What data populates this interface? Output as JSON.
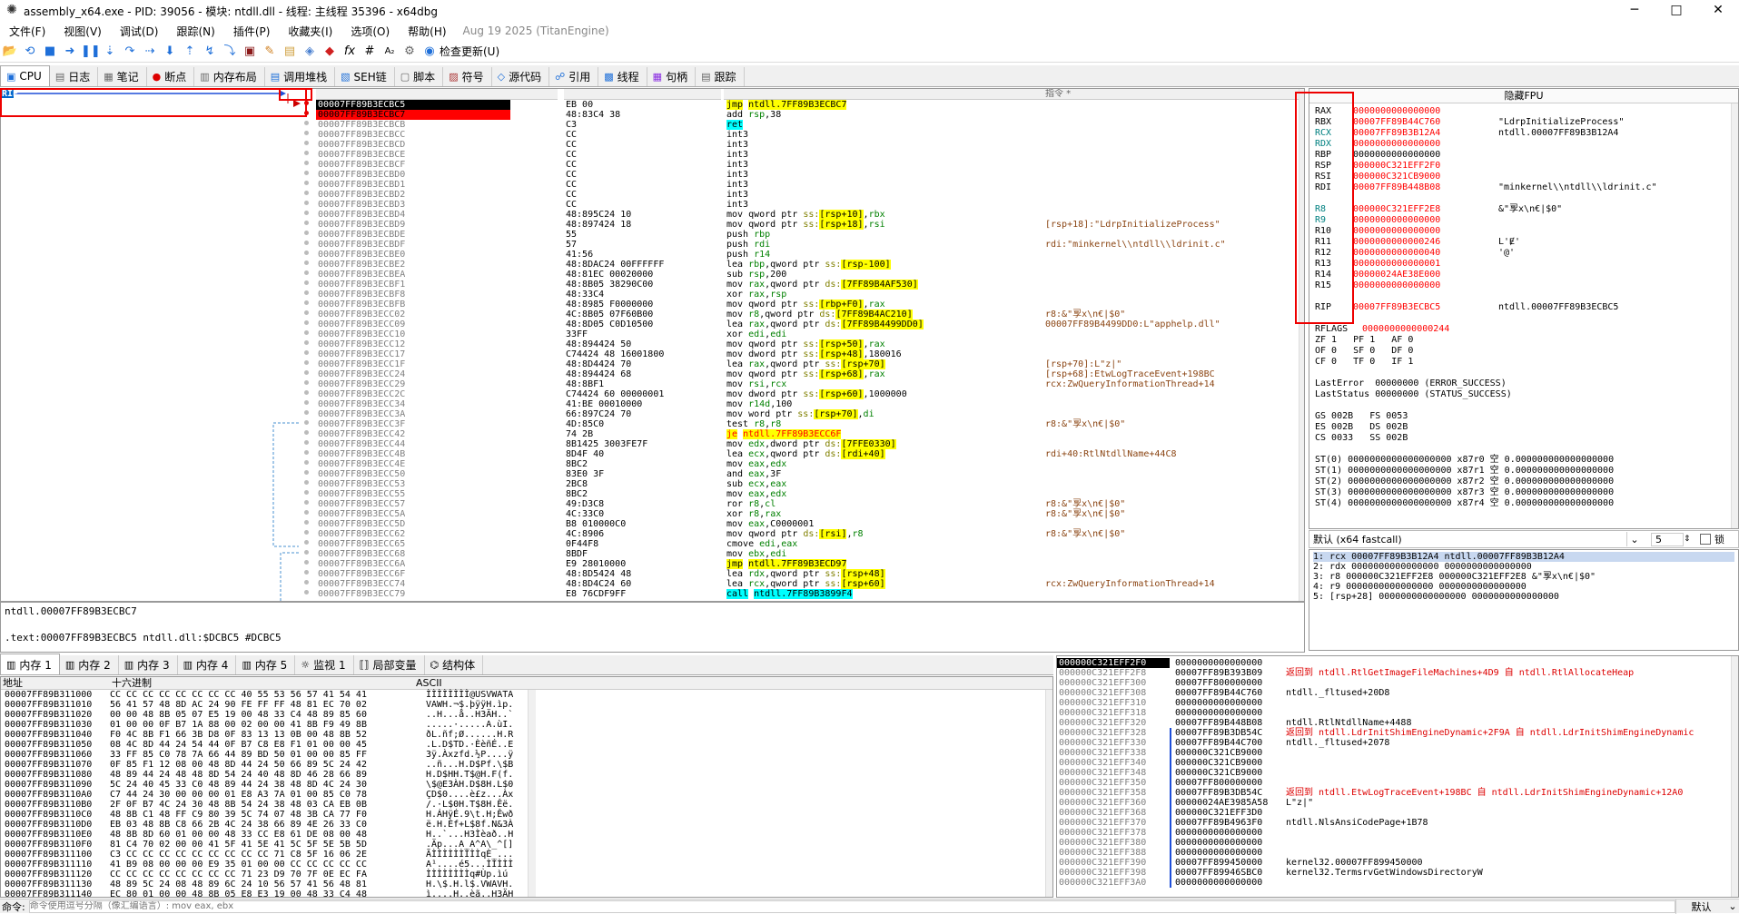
{
  "window": {
    "title": "assembly_x64.exe - PID: 39056 - 模块: ntdll.dll - 线程: 主线程 35396 - x64dbg",
    "minimize": "─",
    "maximize": "□",
    "close": "✕"
  },
  "menu": {
    "items": [
      "文件(F)",
      "视图(V)",
      "调试(D)",
      "跟踪(N)",
      "插件(P)",
      "收藏夹(I)",
      "选项(O)",
      "帮助(H)"
    ],
    "version": "Aug 19 2025 (TitanEngine)"
  },
  "toolbar": {
    "icons": [
      "open-icon",
      "restart-icon",
      "stop-icon",
      "run-icon",
      "pause-icon",
      "step-into-icon",
      "step-over-icon",
      "run-to-return-icon",
      "run-to-user-icon",
      "step-out-icon",
      "trace-into-icon",
      "trace-over-icon",
      "scylla-icon",
      "patch-icon",
      "comment-icon",
      "label-icon",
      "bookmark-icon",
      "function-icon",
      "hash-icon",
      "font-icon",
      "options-icon",
      "update-icon"
    ],
    "update_label": "检查更新(U)"
  },
  "tabs": [
    {
      "icon": "cpu-icon",
      "label": "CPU"
    },
    {
      "icon": "log-icon",
      "label": "日志"
    },
    {
      "icon": "notes-icon",
      "label": "笔记"
    },
    {
      "icon": "breakpoint-icon",
      "label": "断点"
    },
    {
      "icon": "memory-map-icon",
      "label": "内存布局"
    },
    {
      "icon": "callstack-icon",
      "label": "调用堆栈"
    },
    {
      "icon": "seh-icon",
      "label": "SEH链"
    },
    {
      "icon": "script-icon",
      "label": "脚本"
    },
    {
      "icon": "symbols-icon",
      "label": "符号"
    },
    {
      "icon": "source-icon",
      "label": "源代码"
    },
    {
      "icon": "references-icon",
      "label": "引用"
    },
    {
      "icon": "threads-icon",
      "label": "线程"
    },
    {
      "icon": "handles-icon",
      "label": "句柄"
    },
    {
      "icon": "trace-icon",
      "label": "跟踪"
    }
  ],
  "cpu": {
    "rip_label": "RIP",
    "col_header": "指令 *",
    "rows": [
      {
        "addr": "00007FF89B3ECBC5",
        "bytes": "EB 00",
        "asm": "jmp ntdll.7FF89B3ECBC7",
        "cmt": ""
      },
      {
        "addr": "00007FF89B3ECBC7",
        "bytes": "48:83C4 38",
        "asm": "add rsp,38",
        "cmt": ""
      },
      {
        "addr": "00007FF89B3ECBCB",
        "bytes": "C3",
        "asm": "ret",
        "cmt": ""
      },
      {
        "addr": "00007FF89B3ECBCC",
        "bytes": "CC",
        "asm": "int3",
        "cmt": ""
      },
      {
        "addr": "00007FF89B3ECBCD",
        "bytes": "CC",
        "asm": "int3",
        "cmt": ""
      },
      {
        "addr": "00007FF89B3ECBCE",
        "bytes": "CC",
        "asm": "int3",
        "cmt": ""
      },
      {
        "addr": "00007FF89B3ECBCF",
        "bytes": "CC",
        "asm": "int3",
        "cmt": ""
      },
      {
        "addr": "00007FF89B3ECBD0",
        "bytes": "CC",
        "asm": "int3",
        "cmt": ""
      },
      {
        "addr": "00007FF89B3ECBD1",
        "bytes": "CC",
        "asm": "int3",
        "cmt": ""
      },
      {
        "addr": "00007FF89B3ECBD2",
        "bytes": "CC",
        "asm": "int3",
        "cmt": ""
      },
      {
        "addr": "00007FF89B3ECBD3",
        "bytes": "CC",
        "asm": "int3",
        "cmt": ""
      },
      {
        "addr": "00007FF89B3ECBD4",
        "bytes": "48:895C24 10",
        "asm": "mov qword ptr ss:[rsp+10],rbx",
        "cmt": ""
      },
      {
        "addr": "00007FF89B3ECBD9",
        "bytes": "48:897424 18",
        "asm": "mov qword ptr ss:[rsp+18],rsi",
        "cmt": "[rsp+18]:\"LdrpInitializeProcess\""
      },
      {
        "addr": "00007FF89B3ECBDE",
        "bytes": "55",
        "asm": "push rbp",
        "cmt": ""
      },
      {
        "addr": "00007FF89B3ECBDF",
        "bytes": "57",
        "asm": "push rdi",
        "cmt": "rdi:\"minkernel\\\\ntdll\\\\ldrinit.c\""
      },
      {
        "addr": "00007FF89B3ECBE0",
        "bytes": "41:56",
        "asm": "push r14",
        "cmt": ""
      },
      {
        "addr": "00007FF89B3ECBE2",
        "bytes": "48:8DAC24 00FFFFFF",
        "asm": "lea rbp,qword ptr ss:[rsp-100]",
        "cmt": ""
      },
      {
        "addr": "00007FF89B3ECBEA",
        "bytes": "48:81EC 00020000",
        "asm": "sub rsp,200",
        "cmt": ""
      },
      {
        "addr": "00007FF89B3ECBF1",
        "bytes": "48:8B05 38290C00",
        "asm": "mov rax,qword ptr ds:[7FF89B4AF530]",
        "cmt": ""
      },
      {
        "addr": "00007FF89B3ECBF8",
        "bytes": "48:33C4",
        "asm": "xor rax,rsp",
        "cmt": ""
      },
      {
        "addr": "00007FF89B3ECBFB",
        "bytes": "48:8985 F0000000",
        "asm": "mov qword ptr ss:[rbp+F0],rax",
        "cmt": ""
      },
      {
        "addr": "00007FF89B3ECC02",
        "bytes": "4C:8B05 07F60B00",
        "asm": "mov r8,qword ptr ds:[7FF89B4AC210]",
        "cmt": "r8:&\"孠x\\n€|$0\""
      },
      {
        "addr": "00007FF89B3ECC09",
        "bytes": "48:8D05 C0D10500",
        "asm": "lea rax,qword ptr ds:[7FF89B4499DD0]",
        "cmt": "00007FF89B4499DD0:L\"apphelp.dll\""
      },
      {
        "addr": "00007FF89B3ECC10",
        "bytes": "33FF",
        "asm": "xor edi,edi",
        "cmt": ""
      },
      {
        "addr": "00007FF89B3ECC12",
        "bytes": "48:894424 50",
        "asm": "mov qword ptr ss:[rsp+50],rax",
        "cmt": ""
      },
      {
        "addr": "00007FF89B3ECC17",
        "bytes": "C74424 48 16001800",
        "asm": "mov dword ptr ss:[rsp+48],180016",
        "cmt": ""
      },
      {
        "addr": "00007FF89B3ECC1F",
        "bytes": "48:8D4424 70",
        "asm": "lea rax,qword ptr ss:[rsp+70]",
        "cmt": "[rsp+70]:L\"z|\""
      },
      {
        "addr": "00007FF89B3ECC24",
        "bytes": "48:894424 68",
        "asm": "mov qword ptr ss:[rsp+68],rax",
        "cmt": "[rsp+68]:EtwLogTraceEvent+198BC"
      },
      {
        "addr": "00007FF89B3ECC29",
        "bytes": "48:8BF1",
        "asm": "mov rsi,rcx",
        "cmt": "rcx:ZwQueryInformationThread+14"
      },
      {
        "addr": "00007FF89B3ECC2C",
        "bytes": "C74424 60 00000001",
        "asm": "mov dword ptr ss:[rsp+60],1000000",
        "cmt": ""
      },
      {
        "addr": "00007FF89B3ECC34",
        "bytes": "41:BE 00010000",
        "asm": "mov r14d,100",
        "cmt": ""
      },
      {
        "addr": "00007FF89B3ECC3A",
        "bytes": "66:897C24 70",
        "asm": "mov word ptr ss:[rsp+70],di",
        "cmt": ""
      },
      {
        "addr": "00007FF89B3ECC3F",
        "bytes": "4D:85C0",
        "asm": "test r8,r8",
        "cmt": "r8:&\"孠x\\n€|$0\""
      },
      {
        "addr": "00007FF89B3ECC42",
        "bytes": "74 2B",
        "asm": "je ntdll.7FF89B3ECC6F",
        "cmt": ""
      },
      {
        "addr": "00007FF89B3ECC44",
        "bytes": "8B1425 3003FE7F",
        "asm": "mov edx,dword ptr ds:[7FFE0330]",
        "cmt": ""
      },
      {
        "addr": "00007FF89B3ECC4B",
        "bytes": "8D4F 40",
        "asm": "lea ecx,qword ptr ds:[rdi+40]",
        "cmt": "rdi+40:RtlNtdllName+44C8"
      },
      {
        "addr": "00007FF89B3ECC4E",
        "bytes": "8BC2",
        "asm": "mov eax,edx",
        "cmt": ""
      },
      {
        "addr": "00007FF89B3ECC50",
        "bytes": "83E0 3F",
        "asm": "and eax,3F",
        "cmt": ""
      },
      {
        "addr": "00007FF89B3ECC53",
        "bytes": "2BC8",
        "asm": "sub ecx,eax",
        "cmt": ""
      },
      {
        "addr": "00007FF89B3ECC55",
        "bytes": "8BC2",
        "asm": "mov eax,edx",
        "cmt": ""
      },
      {
        "addr": "00007FF89B3ECC57",
        "bytes": "49:D3C8",
        "asm": "ror r8,cl",
        "cmt": "r8:&\"孠x\\n€|$0\""
      },
      {
        "addr": "00007FF89B3ECC5A",
        "bytes": "4C:33C0",
        "asm": "xor r8,rax",
        "cmt": "r8:&\"孠x\\n€|$0\""
      },
      {
        "addr": "00007FF89B3ECC5D",
        "bytes": "B8 010000C0",
        "asm": "mov eax,C0000001",
        "cmt": ""
      },
      {
        "addr": "00007FF89B3ECC62",
        "bytes": "4C:8906",
        "asm": "mov qword ptr ds:[rsi],r8",
        "cmt": "r8:&\"孠x\\n€|$0\""
      },
      {
        "addr": "00007FF89B3ECC65",
        "bytes": "0F44F8",
        "asm": "cmove edi,eax",
        "cmt": ""
      },
      {
        "addr": "00007FF89B3ECC68",
        "bytes": "8BDF",
        "asm": "mov ebx,edi",
        "cmt": ""
      },
      {
        "addr": "00007FF89B3ECC6A",
        "bytes": "E9 28010000",
        "asm": "jmp ntdll.7FF89B3ECD97",
        "cmt": ""
      },
      {
        "addr": "00007FF89B3ECC6F",
        "bytes": "48:8D5424 48",
        "asm": "lea rdx,qword ptr ss:[rsp+48]",
        "cmt": ""
      },
      {
        "addr": "00007FF89B3ECC74",
        "bytes": "48:8D4C24 60",
        "asm": "lea rcx,qword ptr ss:[rsp+60]",
        "cmt": "rcx:ZwQueryInformationThread+14"
      },
      {
        "addr": "00007FF89B3ECC79",
        "bytes": "E8 76CDF9FF",
        "asm": "call ntdll.7FF89B3899F4",
        "cmt": ""
      }
    ]
  },
  "info": {
    "line1": "ntdll.00007FF89B3ECBC7",
    "line2": ".text:00007FF89B3ECBC5 ntdll.dll:$DCBC5 #DCBC5"
  },
  "registers": {
    "header": "隐藏FPU",
    "gp": [
      {
        "n": "RAX",
        "v": "0000000000000000",
        "c": ""
      },
      {
        "n": "RBX",
        "v": "00007FF89B44C760",
        "c": "\"LdrpInitializeProcess\""
      },
      {
        "n": "RCX",
        "v": "00007FF89B3B12A4",
        "c": "ntdll.00007FF89B3B12A4"
      },
      {
        "n": "RDX",
        "v": "0000000000000000",
        "c": ""
      },
      {
        "n": "RBP",
        "v": "0000000000000000",
        "c": ""
      },
      {
        "n": "RSP",
        "v": "000000C321EFF2F0",
        "c": ""
      },
      {
        "n": "RSI",
        "v": "000000C321CB9000",
        "c": ""
      },
      {
        "n": "RDI",
        "v": "00007FF89B448B08",
        "c": "\"minkernel\\\\ntdll\\\\ldrinit.c\""
      },
      {
        "n": "",
        "v": "",
        "c": ""
      },
      {
        "n": "R8",
        "v": "000000C321EFF2E8",
        "c": "&\"孠x\\n€|$0\""
      },
      {
        "n": "R9",
        "v": "0000000000000000",
        "c": ""
      },
      {
        "n": "R10",
        "v": "0000000000000000",
        "c": ""
      },
      {
        "n": "R11",
        "v": "0000000000000246",
        "c": "L'Ɇ'"
      },
      {
        "n": "R12",
        "v": "0000000000000040",
        "c": "'@'"
      },
      {
        "n": "R13",
        "v": "0000000000000001",
        "c": ""
      },
      {
        "n": "R14",
        "v": "00000024AE38E000",
        "c": ""
      },
      {
        "n": "R15",
        "v": "0000000000000000",
        "c": ""
      },
      {
        "n": "",
        "v": "",
        "c": ""
      },
      {
        "n": "RIP",
        "v": "00007FF89B3ECBC5",
        "c": "ntdll.00007FF89B3ECBC5"
      }
    ],
    "rflags_label": "RFLAGS",
    "rflags": "0000000000000244",
    "flags": [
      "ZF 1   PF 1   AF 0",
      "OF 0   SF 0   DF 0",
      "CF 0   TF 0   IF 1"
    ],
    "last_error": "LastError  00000000 (ERROR_SUCCESS)",
    "last_status": "LastStatus 00000000 (STATUS_SUCCESS)",
    "segs": [
      "GS 002B   FS 0053",
      "ES 002B   DS 002B",
      "CS 0033   SS 002B"
    ],
    "st": [
      "ST(0) 0000000000000000000 x87r0 空 0.000000000000000000",
      "ST(1) 0000000000000000000 x87r1 空 0.000000000000000000",
      "ST(2) 0000000000000000000 x87r2 空 0.000000000000000000",
      "ST(3) 0000000000000000000 x87r3 空 0.000000000000000000",
      "ST(4) 0000000000000000000 x87r4 空 0.000000000000000000"
    ]
  },
  "callconv": {
    "label": "默认 (x64 fastcall)",
    "count": "5",
    "lock_label": "锁"
  },
  "args": [
    "1: rcx 00007FF89B3B12A4 ntdll.00007FF89B3B12A4",
    "2: rdx 0000000000000000 0000000000000000",
    "3: r8 000000C321EFF2E8 000000C321EFF2E8 &\"孠x\\n€|$0\"",
    "4: r9 0000000000000000 0000000000000000",
    "5: [rsp+28] 0000000000000000 0000000000000000"
  ],
  "memtabs": [
    {
      "icon": "memory-icon",
      "label": "内存 1"
    },
    {
      "icon": "memory-icon",
      "label": "内存 2"
    },
    {
      "icon": "memory-icon",
      "label": "内存 3"
    },
    {
      "icon": "memory-icon",
      "label": "内存 4"
    },
    {
      "icon": "memory-icon",
      "label": "内存 5"
    },
    {
      "icon": "watch-icon",
      "label": "监视 1"
    },
    {
      "icon": "locals-icon",
      "label": "局部变量"
    },
    {
      "icon": "struct-icon",
      "label": "结构体"
    }
  ],
  "dump": {
    "headers": [
      "地址",
      "十六进制",
      "ASCII"
    ],
    "rows": [
      {
        "a": "00007FF89B311000",
        "h": "CC CC CC CC CC CC CC CC 40 55 53 56 57 41 54 41",
        "s": "ÌÌÌÌÌÌÌÌ@USVWATA"
      },
      {
        "a": "00007FF89B311010",
        "h": "56 41 57 48 8D AC 24 90 FE FF FF 48 81 EC 70 02",
        "s": "VAWH.¬$.þÿÿH.ìp."
      },
      {
        "a": "00007FF89B311020",
        "h": "00 00 48 8B 05 07 E5 19 00 48 33 C4 48 89 85 60",
        "s": "..H...å..H3ÄH..`"
      },
      {
        "a": "00007FF89B311030",
        "h": "01 00 00 0F B7 1A 88 00 02 00 00 41 8B F9 49 8B",
        "s": ".....·.....A.ùI."
      },
      {
        "a": "00007FF89B311040",
        "h": "F0 4C 8B F1 66 3B D8 0F 83 13 13 0B 00 48 8B 52",
        "s": "ðL.ñf;Ø......H.R"
      },
      {
        "a": "00007FF89B311050",
        "h": "08 4C 8D 44 24 54 44 0F B7 C8 E8 F1 01 00 00 45",
        "s": ".L.D$TD.·ÈèñÉ..E"
      },
      {
        "a": "00007FF89B311060",
        "h": "33 FF 85 C0 78 7A 66 44 89 BD 50 01 00 00 85 FF",
        "s": "3ÿ.Àxzfd.½P....ÿ"
      },
      {
        "a": "00007FF89B311070",
        "h": "0F 85 F1 12 08 00 48 8D 44 24 50 66 89 5C 24 42",
        "s": "..ñ...H.D$Pf.\\$B"
      },
      {
        "a": "00007FF89B311080",
        "h": "48 89 44 24 48 48 8D 54 24 40 48 8D 46 28 66 89",
        "s": "H.D$HH.T$@H.F(f."
      },
      {
        "a": "00007FF89B311090",
        "h": "5C 24 40 45 33 C0 48 89 44 24 38 48 8D 4C 24 30",
        "s": "\\$@E3ÀH.D$8H.L$0"
      },
      {
        "a": "00007FF89B3110A0",
        "h": "C7 44 24 30 00 00 00 01 E8 A3 7A 01 00 85 C0 78",
        "s": "ÇD$0....è£z...Àx"
      },
      {
        "a": "00007FF89B3110B0",
        "h": "2F 0F B7 4C 24 30 48 8B 54 24 38 48 03 CA EB 0B",
        "s": "/.·L$0H.T$8H.Êë."
      },
      {
        "a": "00007FF89B3110C0",
        "h": "48 8B C1 48 FF C9 80 39 5C 74 07 48 3B CA 77 F0",
        "s": "H.ÁHÿÉ.9\\t.H;Êwð"
      },
      {
        "a": "00007FF89B3110D0",
        "h": "EB 03 48 8B C8 66 2B 4C 24 38 66 89 4E 26 33 C0",
        "s": "ë.H.Èf+L$8f.N&3À"
      },
      {
        "a": "00007FF89B3110E0",
        "h": "48 8B 8D 60 01 00 00 48 33 CC E8 61 DE 08 00 48",
        "s": "H..`...H3Ìèað..H"
      },
      {
        "a": "00007FF89B3110F0",
        "h": "81 C4 70 02 00 00 41 5F 41 5E 41 5C 5F 5E 5B 5D",
        "s": ".Äp...A_A^A\\_^[]"
      },
      {
        "a": "00007FF89B311100",
        "h": "C3 CC CC CC CC CC CC CC CC CC 71 C8 5F 16 06 2E",
        "s": "ÃÌÌÌÌÌÌÌÌÌqÈ_..."
      },
      {
        "a": "00007FF89B311110",
        "h": "41 B9 08 00 00 00 E9 35 01 00 00 CC CC CC CC CC",
        "s": "A¹....é5...ÌÌÌÌÌ"
      },
      {
        "a": "00007FF89B311120",
        "h": "CC CC CC CC CC CC CC CC 71 23 D9 70 7F 0E EC FA",
        "s": "ÌÌÌÌÌÌÌÌq#Ùp.ìú"
      },
      {
        "a": "00007FF89B311130",
        "h": "48 89 5C 24 08 48 89 6C 24 10 56 57 41 56 48 81",
        "s": "H.\\$.H.l$.VWAVH."
      },
      {
        "a": "00007FF89B311140",
        "h": "EC 80 01 00 00 48 8B 05 E8 E3 19 00 48 33 C4 48",
        "s": "ì....H..èã..H3ÄH"
      }
    ]
  },
  "stack": {
    "rows": [
      {
        "a": "000000C321EFF2F0",
        "v": "0000000000000000",
        "c": "",
        "cur": true
      },
      {
        "a": "000000C321EFF2F8",
        "v": "00007FF89B393B09",
        "c": "返回到 ntdll.RtlGetImageFileMachines+4D9 自 ntdll.RtlAllocateHeap",
        "red": true
      },
      {
        "a": "000000C321EFF300",
        "v": "00007FF800000000",
        "c": ""
      },
      {
        "a": "000000C321EFF308",
        "v": "00007FF89B44C760",
        "c": "ntdll._fltused+20D8"
      },
      {
        "a": "000000C321EFF310",
        "v": "0000000000000000",
        "c": ""
      },
      {
        "a": "000000C321EFF318",
        "v": "0000000000000000",
        "c": ""
      },
      {
        "a": "000000C321EFF320",
        "v": "00007FF89B448B08",
        "c": "ntdll.RtlNtdllName+4488"
      },
      {
        "a": "000000C321EFF328",
        "v": "00007FF89B3DB54C",
        "c": "返回到 ntdll.LdrInitShimEngineDynamic+2F9A 自 ntdll.LdrInitShimEngineDynamic",
        "red": true
      },
      {
        "a": "000000C321EFF330",
        "v": "00007FF89B44C700",
        "c": "ntdll._fltused+2078"
      },
      {
        "a": "000000C321EFF338",
        "v": "000000C321CB9000",
        "c": ""
      },
      {
        "a": "000000C321EFF340",
        "v": "000000C321CB9000",
        "c": ""
      },
      {
        "a": "000000C321EFF348",
        "v": "000000C321CB9000",
        "c": ""
      },
      {
        "a": "000000C321EFF350",
        "v": "00007FF800000000",
        "c": ""
      },
      {
        "a": "000000C321EFF358",
        "v": "00007FF89B3DB54C",
        "c": "返回到 ntdll.EtwLogTraceEvent+198BC 自 ntdll.LdrInitShimEngineDynamic+12A0",
        "red": true
      },
      {
        "a": "000000C321EFF360",
        "v": "00000024AE3985A58",
        "c": "L\"z|\""
      },
      {
        "a": "000000C321EFF368",
        "v": "000000C321EFF3D0",
        "c": ""
      },
      {
        "a": "000000C321EFF370",
        "v": "00007FF89B4963F0",
        "c": "ntdll.NlsAnsiCodePage+1B78"
      },
      {
        "a": "000000C321EFF378",
        "v": "0000000000000000",
        "c": ""
      },
      {
        "a": "000000C321EFF380",
        "v": "0000000000000000",
        "c": ""
      },
      {
        "a": "000000C321EFF388",
        "v": "0000000000000000",
        "c": ""
      },
      {
        "a": "000000C321EFF390",
        "v": "00007FF899450000",
        "c": "kernel32.00007FF899450000"
      },
      {
        "a": "000000C321EFF398",
        "v": "00007FF89946SBC0",
        "c": "kernel32.TermsrvGetWindowsDirectoryW"
      },
      {
        "a": "000000C321EFF3A0",
        "v": "0000000000000000",
        "c": ""
      }
    ]
  },
  "cmdbar": {
    "label": "命令:",
    "placeholder": "命令使用逗号分隔（像汇编语言）: mov eax, ebx",
    "right": "默认"
  }
}
